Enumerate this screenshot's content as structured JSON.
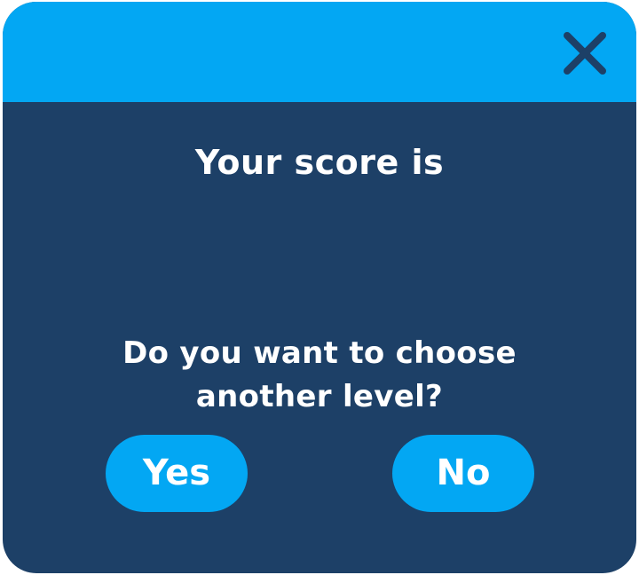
{
  "dialog": {
    "close_icon": "close-x-icon",
    "score_title": "Your score is",
    "score_value": "",
    "question": "Do you want to choose another level?",
    "yes_label": "Yes",
    "no_label": "No"
  },
  "colors": {
    "titlebar": "#03a7f3",
    "body": "#1d4067",
    "button": "#03a7f3",
    "close_icon": "#1d4067",
    "text": "#ffffff"
  }
}
